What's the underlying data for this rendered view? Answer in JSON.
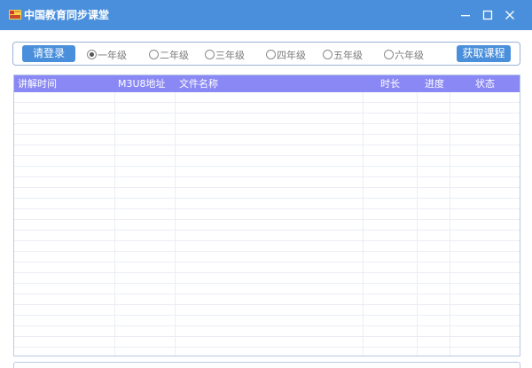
{
  "window": {
    "title": "中国教育同步课堂",
    "icon": "app-icon",
    "controls": [
      "minimize-icon",
      "maximize-icon",
      "close-icon"
    ]
  },
  "toolbar": {
    "login_label": "请登录",
    "fetch_label": "获取课程",
    "grades": [
      {
        "label": "一年级",
        "selected": true
      },
      {
        "label": "二年级",
        "selected": false
      },
      {
        "label": "三年级",
        "selected": false
      },
      {
        "label": "四年级",
        "selected": false
      },
      {
        "label": "五年级",
        "selected": false
      },
      {
        "label": "六年级",
        "selected": false
      }
    ]
  },
  "table": {
    "columns": [
      "讲解时间",
      "M3U8地址",
      "文件名称",
      "时长",
      "进度",
      "状态"
    ],
    "rows": []
  },
  "colors": {
    "accent": "#4a8fdb",
    "header": "#8a88f5"
  }
}
